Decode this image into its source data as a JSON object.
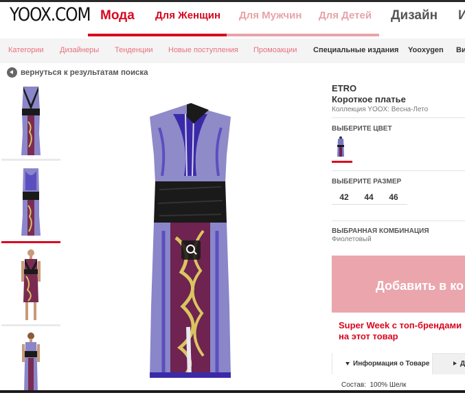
{
  "header": {
    "logo": "YOOX.COM",
    "nav": [
      "Мода",
      "Для Женщин",
      "Для Мужчин",
      "Для Детей",
      "Дизайн",
      "И"
    ]
  },
  "subnav": [
    "Категории",
    "Дизайнеры",
    "Тенденции",
    "Новые поступления",
    "Промоакции",
    "Специальные издания",
    "Yooxygen",
    "Ви"
  ],
  "back_link": "вернуться к результатам поиска",
  "product": {
    "brand": "ETRO",
    "name": "Короткое платье",
    "collection": "Коллекция YOOX: Весна-Лето",
    "color_label": "ВЫБЕРИТЕ ЦВЕТ",
    "size_label": "ВЫБЕРИТЕ РАЗМЕР",
    "sizes": [
      "42",
      "44",
      "46"
    ],
    "combo_label": "ВЫБРАННАЯ КОМБИНАЦИЯ",
    "combo_value": "Фиолетовый",
    "add_button": "Добавить в ко",
    "promo_line1": "Super Week с топ-брендами",
    "promo_line2": "на этот товар",
    "tab_info": "Информация о Товаре",
    "tab_other": "Д",
    "composition_label": "Состав:",
    "composition_value": "100% Шелк"
  },
  "colors": {
    "brand_red": "#d8061f",
    "pink": "#e8a3a9",
    "button_pink": "#eaa6ac"
  }
}
